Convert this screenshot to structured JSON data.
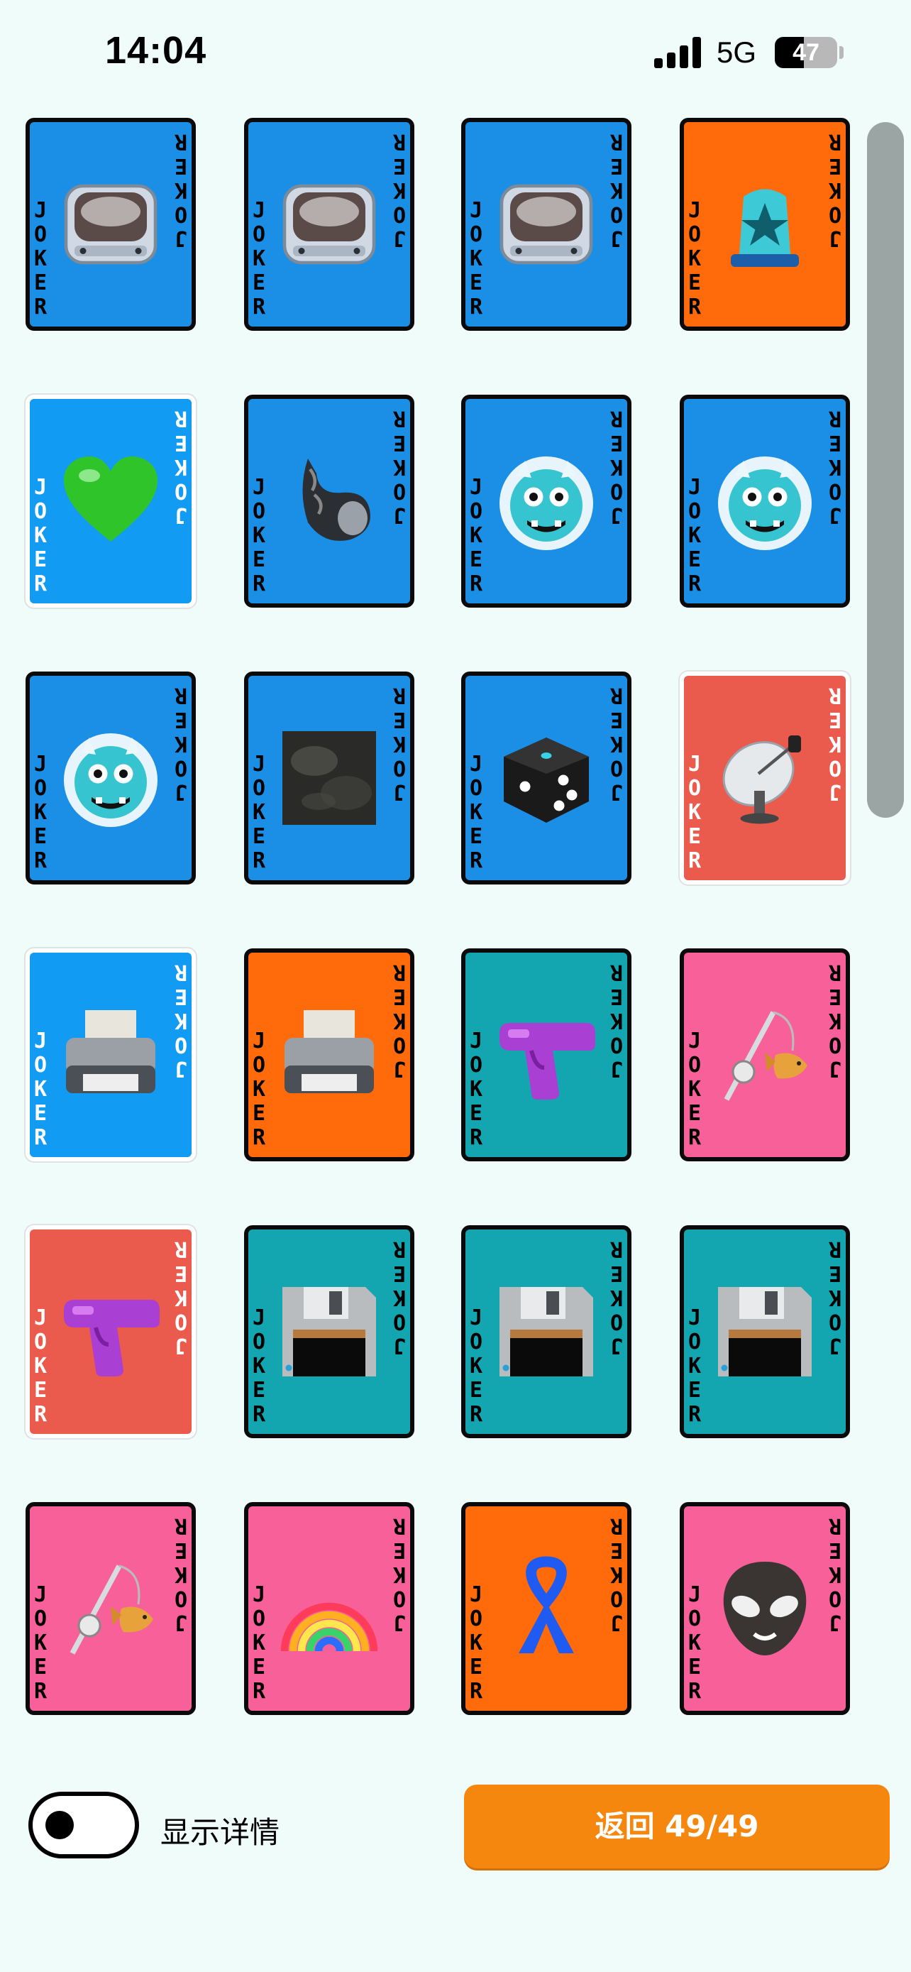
{
  "status_bar": {
    "time": "14:04",
    "network": "5G",
    "battery": "47",
    "battery_fraction": 0.47
  },
  "card_label": "JOKER",
  "cards": [
    {
      "icon": "tv-icon",
      "bg": "#1b8fe6",
      "frame": "dark"
    },
    {
      "icon": "tv-icon",
      "bg": "#1b8fe6",
      "frame": "dark"
    },
    {
      "icon": "tv-icon",
      "bg": "#1b8fe6",
      "frame": "dark"
    },
    {
      "icon": "siren-icon",
      "bg": "#ff6a0a",
      "frame": "dark"
    },
    {
      "icon": "green-heart-icon",
      "bg": "#129bf2",
      "frame": "light"
    },
    {
      "icon": "spiral-shell-icon",
      "bg": "#1b8fe6",
      "frame": "dark"
    },
    {
      "icon": "ogre-mask-icon",
      "bg": "#1b8fe6",
      "frame": "dark"
    },
    {
      "icon": "ogre-mask-icon",
      "bg": "#1b8fe6",
      "frame": "dark"
    },
    {
      "icon": "ogre-mask-icon",
      "bg": "#1b8fe6",
      "frame": "dark"
    },
    {
      "icon": "rock-icon",
      "bg": "#1b8fe6",
      "frame": "dark"
    },
    {
      "icon": "dice-icon",
      "bg": "#1b8fe6",
      "frame": "dark"
    },
    {
      "icon": "satellite-dish-icon",
      "bg": "#ea5a4d",
      "frame": "light"
    },
    {
      "icon": "printer-icon",
      "bg": "#129bf2",
      "frame": "light"
    },
    {
      "icon": "printer-icon",
      "bg": "#ff6a0a",
      "frame": "dark"
    },
    {
      "icon": "water-pistol-icon",
      "bg": "#13a5b0",
      "frame": "dark"
    },
    {
      "icon": "fishing-pole-icon",
      "bg": "#f8609a",
      "frame": "dark"
    },
    {
      "icon": "water-pistol-icon",
      "bg": "#ea5a4d",
      "frame": "light"
    },
    {
      "icon": "floppy-disk-icon",
      "bg": "#13a5b0",
      "frame": "dark"
    },
    {
      "icon": "floppy-disk-icon",
      "bg": "#13a5b0",
      "frame": "dark"
    },
    {
      "icon": "floppy-disk-icon",
      "bg": "#13a5b0",
      "frame": "dark"
    },
    {
      "icon": "fishing-pole-icon",
      "bg": "#f8609a",
      "frame": "dark"
    },
    {
      "icon": "rainbow-icon",
      "bg": "#f8609a",
      "frame": "dark"
    },
    {
      "icon": "ribbon-icon",
      "bg": "#ff6a0a",
      "frame": "dark"
    },
    {
      "icon": "alien-icon",
      "bg": "#f8609a",
      "frame": "dark"
    }
  ],
  "footer": {
    "toggle_label": "显示详情",
    "toggle_on": false,
    "back_button_label": "返回 49/49"
  },
  "colors": {
    "background": "#effcfa",
    "accent": "#f5870e"
  }
}
